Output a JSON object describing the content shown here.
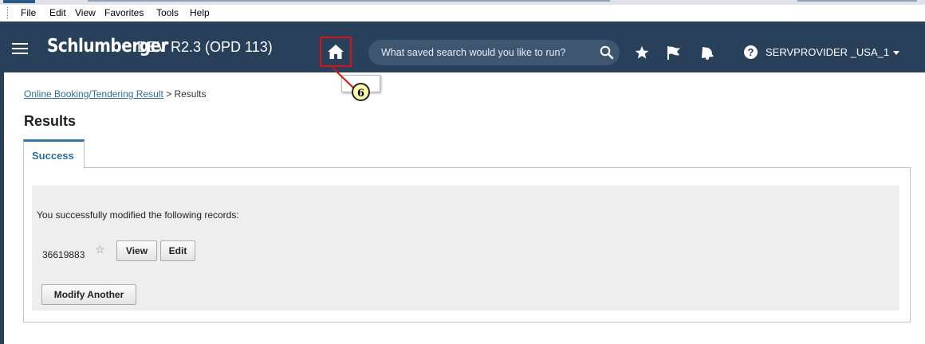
{
  "menu": {
    "file": "File",
    "edit": "Edit",
    "view": "View",
    "favorites": "Favorites",
    "tools": "Tools",
    "help": "Help"
  },
  "header": {
    "brand": "Schlumberger",
    "environment": "DEV R2.3 (OPD 113)",
    "search_placeholder": "What saved search would you like to run?",
    "user": "SERVPROVIDER _USA_1",
    "help_glyph": "?",
    "icons": [
      "menu-icon",
      "home-icon",
      "search-icon",
      "star-icon",
      "flag-icon",
      "bell-icon",
      "help-icon",
      "chevron-down-icon"
    ]
  },
  "callout": {
    "number": "6"
  },
  "breadcrumb": {
    "link": "Online Booking/Tendering Result",
    "separator": " > ",
    "current": "Results"
  },
  "page": {
    "title": "Results"
  },
  "tabs": [
    {
      "label": "Success"
    }
  ],
  "result": {
    "message": "You successfully modified the following records:",
    "record_id": "36619883",
    "view_label": "View",
    "edit_label": "Edit",
    "modify_another_label": "Modify Another"
  },
  "colors": {
    "header_bg": "#28405a",
    "search_bg": "#3f5670",
    "link": "#2b6f9c",
    "tab_accent": "#2b78b6",
    "highlight_box": "#e01010",
    "callout_fill": "#fff9b0"
  }
}
